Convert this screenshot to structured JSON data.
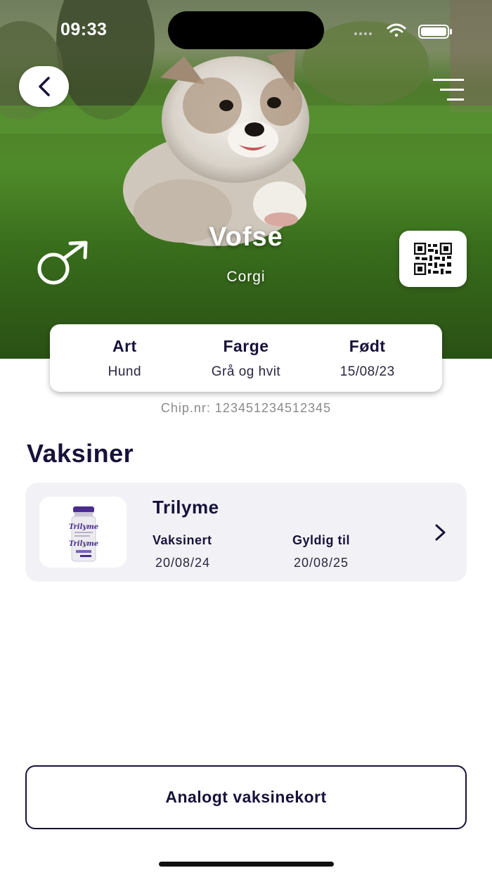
{
  "status_bar": {
    "time": "09:33"
  },
  "pet": {
    "name": "Vofse",
    "breed": "Corgi",
    "gender": "male-icon"
  },
  "info": [
    {
      "label": "Art",
      "value": "Hund"
    },
    {
      "label": "Farge",
      "value": "Grå og hvit"
    },
    {
      "label": "Født",
      "value": "15/08/23"
    }
  ],
  "chip_text": "Chip.nr: 123451234512345",
  "vaccines": {
    "title": "Vaksiner",
    "items": [
      {
        "name": "Trilyme",
        "vaccinated_label": "Vaksinert",
        "vaccinated_date": "20/08/24",
        "valid_label": "Gyldig til",
        "valid_date": "20/08/25",
        "image_text": "Trilyme"
      }
    ]
  },
  "analog_button": "Analogt vaksinekort",
  "colors": {
    "text_primary": "#17123a",
    "card_bg": "#f2f2f6",
    "vial_cap": "#4a2c8f"
  },
  "icons": [
    "back-icon",
    "menu-icon",
    "male-icon",
    "qr-code-icon",
    "chevron-right-icon",
    "wifi-icon",
    "battery-icon",
    "signal-icon"
  ]
}
